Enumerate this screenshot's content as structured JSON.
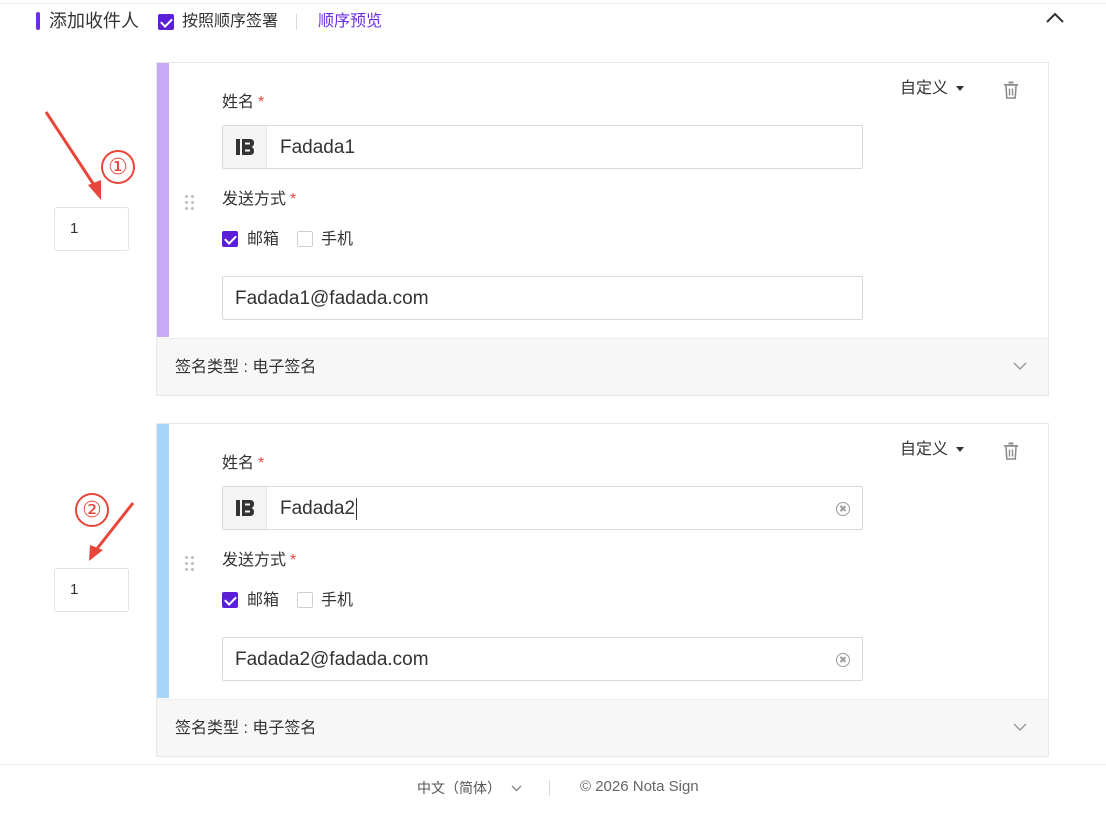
{
  "header": {
    "title": "添加收件人",
    "sequential_label": "按照顺序签署",
    "sequential_checked": true,
    "preview_link": "顺序预览"
  },
  "annotations": {
    "marker_1": "①",
    "marker_2": "②"
  },
  "recipients": [
    {
      "order": "1",
      "stripe_color": "#c8a9f5",
      "name_label": "姓名",
      "name_value": "Fadada1",
      "send_method_label": "发送方式",
      "email_option": "邮箱",
      "email_checked": true,
      "phone_option": "手机",
      "phone_checked": false,
      "email_value": "Fadada1@fadada.com",
      "custom_label": "自定义",
      "signature_type": "签名类型 : 电子签名",
      "show_clear": false
    },
    {
      "order": "1",
      "stripe_color": "#a6d6fb",
      "name_label": "姓名",
      "name_value": "Fadada2",
      "send_method_label": "发送方式",
      "email_option": "邮箱",
      "email_checked": true,
      "phone_option": "手机",
      "phone_checked": false,
      "email_value": "Fadada2@fadada.com",
      "custom_label": "自定义",
      "signature_type": "签名类型 : 电子签名",
      "show_clear": true
    }
  ],
  "footer": {
    "language": "中文（简体）",
    "copyright": "© 2026 Nota Sign"
  },
  "colors": {
    "accent": "#5b1fd6",
    "required": "#e8463a",
    "annotation": "#e8463a"
  }
}
